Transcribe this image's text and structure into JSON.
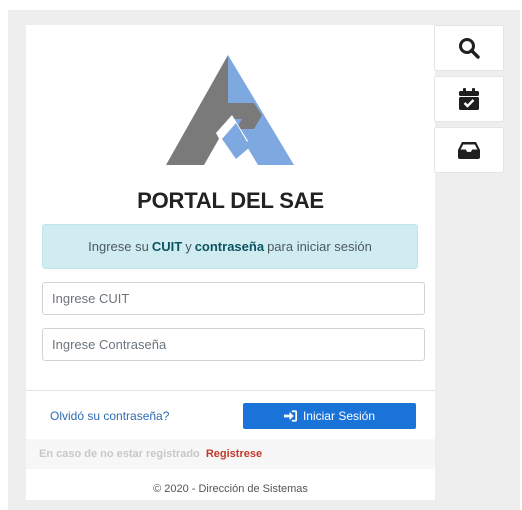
{
  "header": {
    "title_part1": "PORTAL",
    "title_part2": "DEL",
    "title_part3": "SAE"
  },
  "alert": {
    "prefix": "Ingrese su",
    "cuit": "CUIT",
    "conjunction": "y",
    "password": "contraseña",
    "suffix": "para iniciar sesión"
  },
  "form": {
    "cuit_placeholder": "Ingrese CUIT",
    "password_placeholder": "Ingrese Contraseña",
    "forgot_label": "Olvidó su contraseña?",
    "login_label": "Iniciar Sesión"
  },
  "register": {
    "note": "En caso de no estar registrado",
    "link": "Registrese"
  },
  "footer": {
    "copyright": "© 2020 - Dirección de Sistemas"
  },
  "sidebar": {
    "buttons": [
      {
        "icon": "search-icon"
      },
      {
        "icon": "calendar-check-icon"
      },
      {
        "icon": "inbox-icon"
      }
    ]
  },
  "colors": {
    "accent": "#1a73d9",
    "alert_bg": "#d1ecf1",
    "register_link": "#c0392b",
    "logo_gray": "#7a7a7a",
    "logo_blue": "#7ea8e0"
  }
}
